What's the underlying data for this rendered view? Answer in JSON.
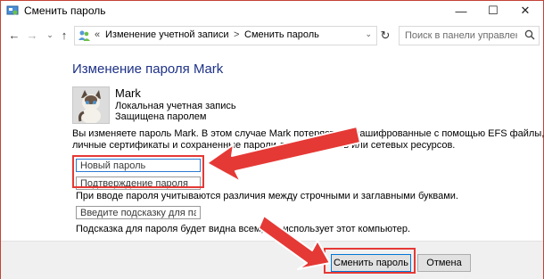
{
  "window": {
    "title": "Сменить пароль",
    "controls": {
      "minimize": "—",
      "maximize": "☐",
      "close": "✕"
    }
  },
  "nav": {
    "back": "←",
    "forward": "→",
    "recent": "⌄",
    "up": "↑",
    "refresh": "↻"
  },
  "address": {
    "prefix": "«",
    "crumbs": [
      "Изменение учетной записи",
      "Сменить пароль"
    ],
    "separator": ">",
    "dropdown": "⌄"
  },
  "search": {
    "placeholder": "Поиск в панели управления"
  },
  "page": {
    "heading": "Изменение пароля Mark",
    "user": {
      "name": "Mark",
      "type": "Локальная учетная запись",
      "protection": "Защищена паролем"
    },
    "warning_line1": "Вы изменяете пароль Mark. В этом случае Mark потеряет все зашифрованные с помощью EFS файлы,",
    "warning_line2": "личные сертификаты и сохраненные пароли для веб-сайтов или сетевых ресурсов.",
    "new_password_placeholder": "Новый пароль",
    "confirm_password_placeholder": "Подтверждение пароля",
    "case_note": "При вводе пароля учитываются различия между строчными и заглавными буквами.",
    "hint_placeholder": "Введите подсказку для пароля",
    "hint_note": "Подсказка для пароля будет видна всем, кто использует этот компьютер."
  },
  "buttons": {
    "change": "Сменить пароль",
    "cancel": "Отмена"
  },
  "colors": {
    "accent": "#0078d7",
    "heading": "#1e3287",
    "annotation": "#e53935"
  }
}
